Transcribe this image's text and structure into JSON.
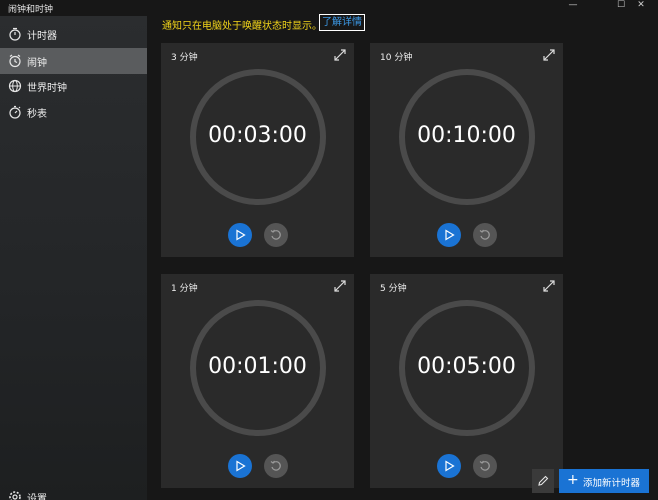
{
  "window": {
    "title": "闹钟和时钟",
    "controls": [
      "—",
      "☐",
      "✕"
    ]
  },
  "sidebar": {
    "items": [
      {
        "label": "计时器",
        "icon": "timer-icon"
      },
      {
        "label": "闹钟",
        "icon": "alarm-icon",
        "selected": true
      },
      {
        "label": "世界时钟",
        "icon": "globe-icon"
      },
      {
        "label": "秒表",
        "icon": "stopwatch-icon"
      }
    ],
    "settings": {
      "label": "设置",
      "icon": "gear-icon"
    }
  },
  "notice": {
    "text": "通知只在电脑处于唤醒状态时显示。",
    "link": "了解详情"
  },
  "timers": [
    {
      "name": "3 分钟",
      "time": "00:03:00"
    },
    {
      "name": "10 分钟",
      "time": "00:10:00"
    },
    {
      "name": "1 分钟",
      "time": "00:01:00"
    },
    {
      "name": "5 分钟",
      "time": "00:05:00"
    }
  ],
  "footer": {
    "add_label": "添加新计时器"
  },
  "colors": {
    "accent": "#1a73d4",
    "notice": "#f2d51a",
    "link": "#3d9be9"
  }
}
